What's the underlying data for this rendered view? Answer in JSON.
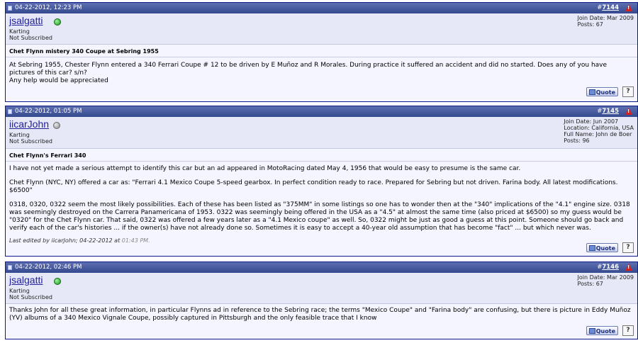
{
  "posts": [
    {
      "date": "04-22-2012, 12:23 PM",
      "post_number": "7144",
      "username": "jsalgatti",
      "online": true,
      "user_title": "Karting",
      "subscription": "Not Subscribed",
      "join_date": "Join Date: Mar 2009",
      "location": "",
      "full_name": "",
      "posts_count": "Posts: 67",
      "subject": "Chet Flynn mistery 340 Coupe at Sebring 1955",
      "paragraphs": [
        "At Sebring 1955, Chester Flynn entered a 340 Ferrari Coupe # 12 to be driven by E Muñoz and R Morales. During practice it suffered an accident and did no started. Does any of you have pictures of this car? s/n?",
        "Any help would be appreciated"
      ],
      "edited_by": "",
      "edited_time": ""
    },
    {
      "date": "04-22-2012, 01:05 PM",
      "post_number": "7145",
      "username": "iicarJohn",
      "online": false,
      "user_title": "Karting",
      "subscription": "Not Subscribed",
      "join_date": "Join Date: Jun 2007",
      "location": "Location: California, USA",
      "full_name": "Full Name: John de Boer",
      "posts_count": "Posts: 96",
      "subject": "Chet Flynn's Ferrari 340",
      "paragraphs": [
        "I have not yet made a serious attempt to identify this car but an ad appeared in MotoRacing dated May 4, 1956 that would be easy to presume is the same car.",
        "Chet Flynn (NYC, NY) offered a car as: \"Ferrari 4.1 Mexico Coupe 5-speed gearbox. In perfect condition ready to race. Prepared for Sebring but not driven. Farina body. All latest modifications. $6500\"",
        "0318, 0320, 0322 seem the most likely possibilities. Each of these has been listed as \"375MM\" in some listings so one has to wonder then at the \"340\" implications of the \"4.1\" engine size. 0318 was seemingly destroyed on the Carrera Panamericana of 1953. 0322 was seemingly being offered in the USA as a \"4.5\" at almost the same time (also priced at $6500) so my guess would be \"0320\" for the Chet Flynn car. That said, 0322 was offered a few years later as a \"4.1 Mexico coupe\" as well. So, 0322 might be just as good a guess at this point. Someone should go back and verify each of the car's histories ... if the owner(s) have not already done so. Sometimes it is easy to accept a 40-year old assumption that has become \"fact\" ... but which never was."
      ],
      "edited_by": "Last edited by iicarJohn; 04-22-2012 at ",
      "edited_time": "01:43 PM."
    },
    {
      "date": "04-22-2012, 02:46 PM",
      "post_number": "7146",
      "username": "jsalgatti",
      "online": true,
      "user_title": "Karting",
      "subscription": "Not Subscribed",
      "join_date": "Join Date: Mar 2009",
      "location": "",
      "full_name": "",
      "posts_count": "Posts: 67",
      "subject": "",
      "paragraphs": [
        "Thanks John for all these great information, in particular Flynns ad in reference to the Sebring race; the terms \"Mexico Coupe\" and \"Farina body\" are confusing, but there is picture in Eddy Muñoz (YV) albums of a 340 Mexico Vignale Coupe, possibly captured in Pittsburgh and the only feasible trace that I know"
      ],
      "edited_by": "",
      "edited_time": ""
    }
  ],
  "labels": {
    "hash": "#",
    "quote": "Quote",
    "multiquote": "?",
    "report": "!"
  },
  "colors": {
    "header_top": "#5e6fb0",
    "header_bottom": "#35498f",
    "post_bg": "#f5f5ff",
    "userbar_bg": "#e6e8f7",
    "username": "#22229c",
    "online": "#1c9b1c",
    "offline": "#8a8a8a"
  }
}
